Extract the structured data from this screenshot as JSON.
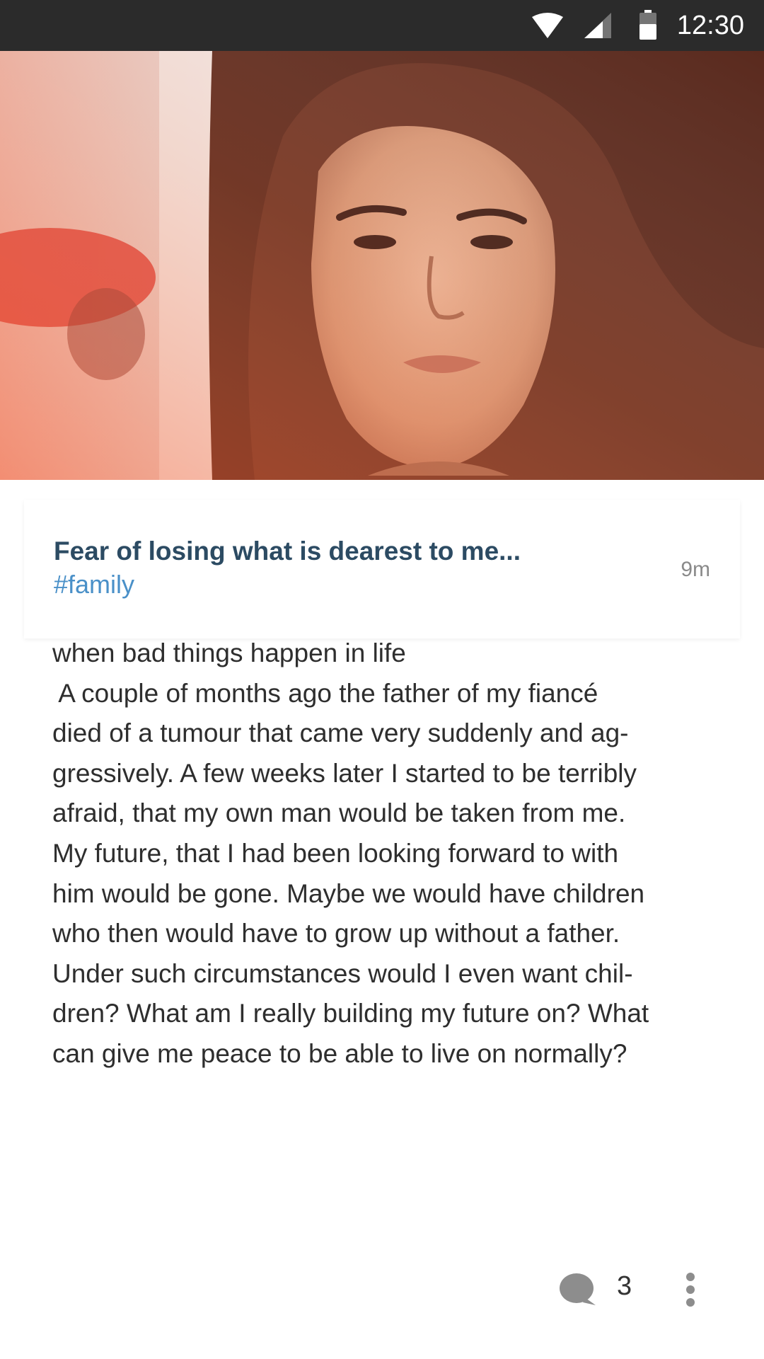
{
  "status_bar": {
    "time": "12:30",
    "icons": [
      "wifi-icon",
      "cellular-signal-icon",
      "battery-icon"
    ]
  },
  "hero_image": {
    "description": "photo-of-woman",
    "colors": {
      "skin": "#d9a58a",
      "hair": "#5a2a1e",
      "car": "#d8403a",
      "background": "#e4d2cc"
    }
  },
  "post": {
    "title": "Fear of losing what is dearest to me...",
    "tag": "#family",
    "time_ago": "9m",
    "body_lines": [
      "when bad things happen in life",
      " A couple of months ago the father of my fiancé",
      "died of a tumour that came very suddenly and ag-",
      "gressively. A few weeks later I started to be terribly",
      "afraid, that my own man would be taken from me.",
      "My future, that I had been looking forward to with",
      "him would be gone. Maybe we would have children",
      "who then would have to grow up without a father.",
      "Under such circumstances would I even want chil-",
      "dren? What am I really building my future on? What",
      "can give me peace to be able to live on normally?"
    ]
  },
  "footer": {
    "comment_count": "3",
    "comment_icon": "comment-bubble-icon",
    "more_icon": "more-vertical-icon"
  },
  "colors": {
    "status_bar_bg": "#2b2b2b",
    "title": "#2c4b63",
    "tag": "#4a90c8",
    "body_text": "#2e2e2e",
    "meta_text": "#8a8a8a",
    "icon_gray": "#8d8d8d"
  }
}
